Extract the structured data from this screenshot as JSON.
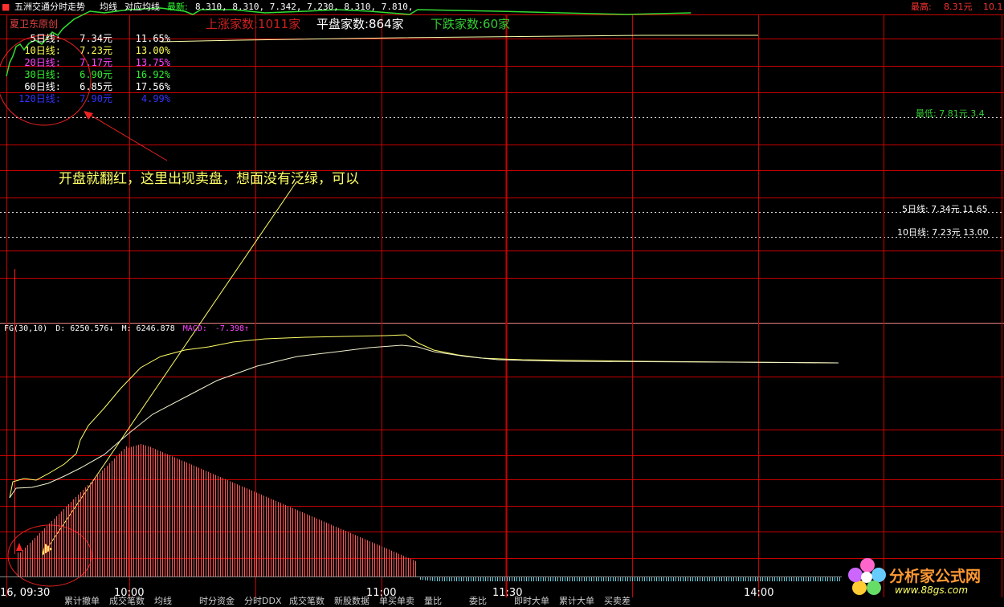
{
  "title_bar": {
    "stock_name": "五洲交通分时走势",
    "tab_avg": "均线",
    "tab_corr": "对应均线",
    "latest_label": "最新:",
    "latest_values": "8.310, 8.310, 7.342, 7.230, 8.310, 7.810,",
    "high_label": "最高:",
    "high_value": "8.31元",
    "high_pct": "10.1"
  },
  "signature": "夏卫东原创",
  "breadth": {
    "up": "上涨家数:1011家",
    "flat": "平盘家数:864家",
    "down": "下跌家数:60家"
  },
  "moving_averages": [
    {
      "name": "5日线:",
      "price": "7.34元",
      "pct": "11.65%",
      "color": "#ffffff"
    },
    {
      "name": "10日线:",
      "price": "7.23元",
      "pct": "13.00%",
      "color": "#ffff55"
    },
    {
      "name": "20日线:",
      "price": "7.17元",
      "pct": "13.75%",
      "color": "#ff44ff"
    },
    {
      "name": "30日线:",
      "price": "6.90元",
      "pct": "16.92%",
      "color": "#33ee33"
    },
    {
      "name": "60日线:",
      "price": "6.85元",
      "pct": "17.56%",
      "color": "#ffffff"
    },
    {
      "name": "120日线:",
      "price": "7.90元",
      "pct": "4.99%",
      "color": "#3333ff"
    }
  ],
  "right_labels": {
    "low": "最低: 7.81元 3.4",
    "ma5": "5日线: 7.34元 11.65",
    "ma10": "10日线: 7.23元 13.00"
  },
  "annotation": "开盘就翻红，这里出现卖盘，想面没有泛绿，可以",
  "indicator": {
    "name": "FG(30,10)",
    "d_value": "D: 6250.576↓",
    "m_value": "M: 6246.878",
    "macd_label": "MACD:",
    "macd_value": "-7.398↑"
  },
  "time_axis": [
    "16, 09:30",
    "10:00",
    "11:00",
    "11:30",
    "14:00"
  ],
  "bottom_menu": [
    "累计撤单",
    "成交笔数",
    "均线",
    "时分资金",
    "分时DDX",
    "成交笔数",
    "新股数据",
    "单买单卖",
    "量比",
    "委比",
    "即时大单",
    "累计大单",
    "买卖差"
  ],
  "logo": {
    "name": "分析家公式网",
    "url": "www.88gs.com"
  },
  "colors": {
    "grid": "#c80000",
    "up": "#ff3333",
    "down": "#33cc33",
    "macd_pos": "#ff5555",
    "macd_neg": "#66ccdd",
    "line_d": "#ffff66",
    "line_m": "#f0f0cc",
    "annotation": "#ffff66"
  }
}
